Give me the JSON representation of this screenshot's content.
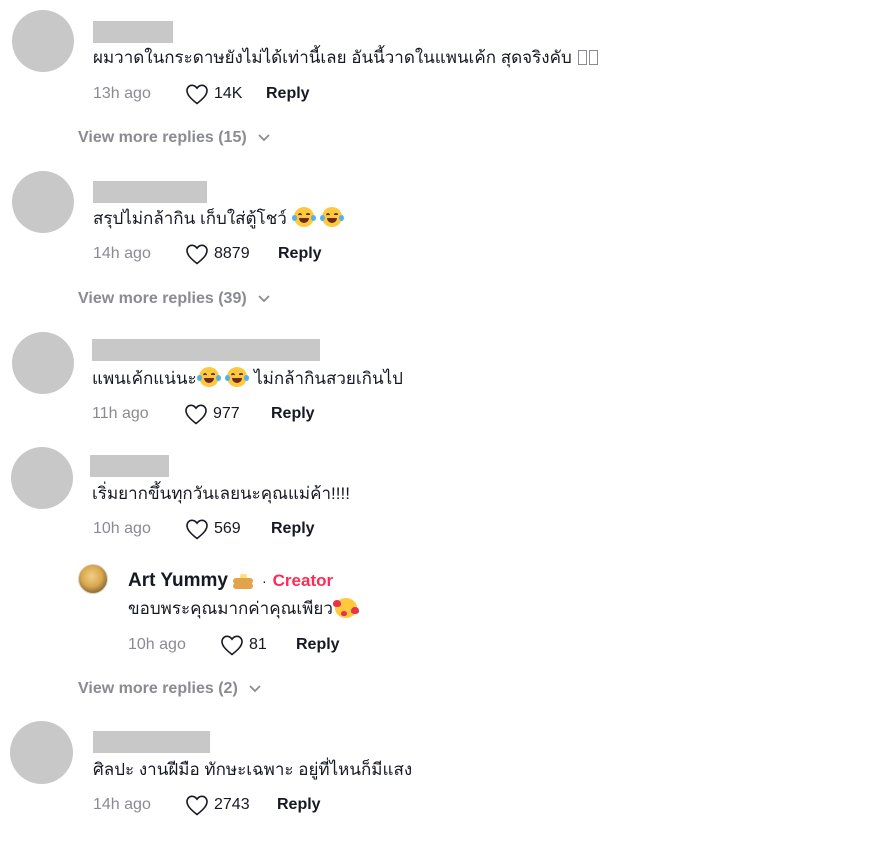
{
  "comments": [
    {
      "text": "ผมวาดในกระดาษยังไม่ได้เท่านี้เลย อันนี้วาดในแพนเค้ก สุดจริงคับ",
      "time": "13h ago",
      "likes": "14K",
      "reply": "Reply",
      "view_more": "View more replies (15)"
    },
    {
      "text": "สรุปไม่กล้ากิน เก็บใส่ตู้โชว์",
      "time": "14h ago",
      "likes": "8879",
      "reply": "Reply",
      "view_more": "View more replies (39)"
    },
    {
      "text_a": "แพนเค้กแน่นะ",
      "text_b": "ไม่กล้ากินสวยเกินไป",
      "time": "11h ago",
      "likes": "977",
      "reply": "Reply"
    },
    {
      "text": "เริ่มยากขึ้นทุกวันเลยนะคุณแม่ค้า!!!!",
      "time": "10h ago",
      "likes": "569",
      "reply": "Reply",
      "view_more": "View more replies (2)"
    },
    {
      "text": "ศิลปะ งานฝีมือ ทักษะเฉพาะ อยู่ที่ไหนก็มีแสง",
      "time": "14h ago",
      "likes": "2743",
      "reply": "Reply"
    }
  ],
  "creator_reply": {
    "name": "Art Yummy",
    "dot": "·",
    "badge": "Creator",
    "text": "ขอบพระคุณมากค่าคุณเพียว",
    "time": "10h ago",
    "likes": "81",
    "reply": "Reply"
  },
  "colors": {
    "creator_badge": "#fe2c55",
    "muted_text": "#8a8b91",
    "placeholder_gray": "#c8c8c8"
  },
  "icons": {
    "like": "heart-outline-icon",
    "expand": "chevron-down-icon",
    "laugh": "face-with-tears-of-joy-icon",
    "love": "smiling-face-with-hearts-icon",
    "pancake": "pancakes-icon"
  }
}
